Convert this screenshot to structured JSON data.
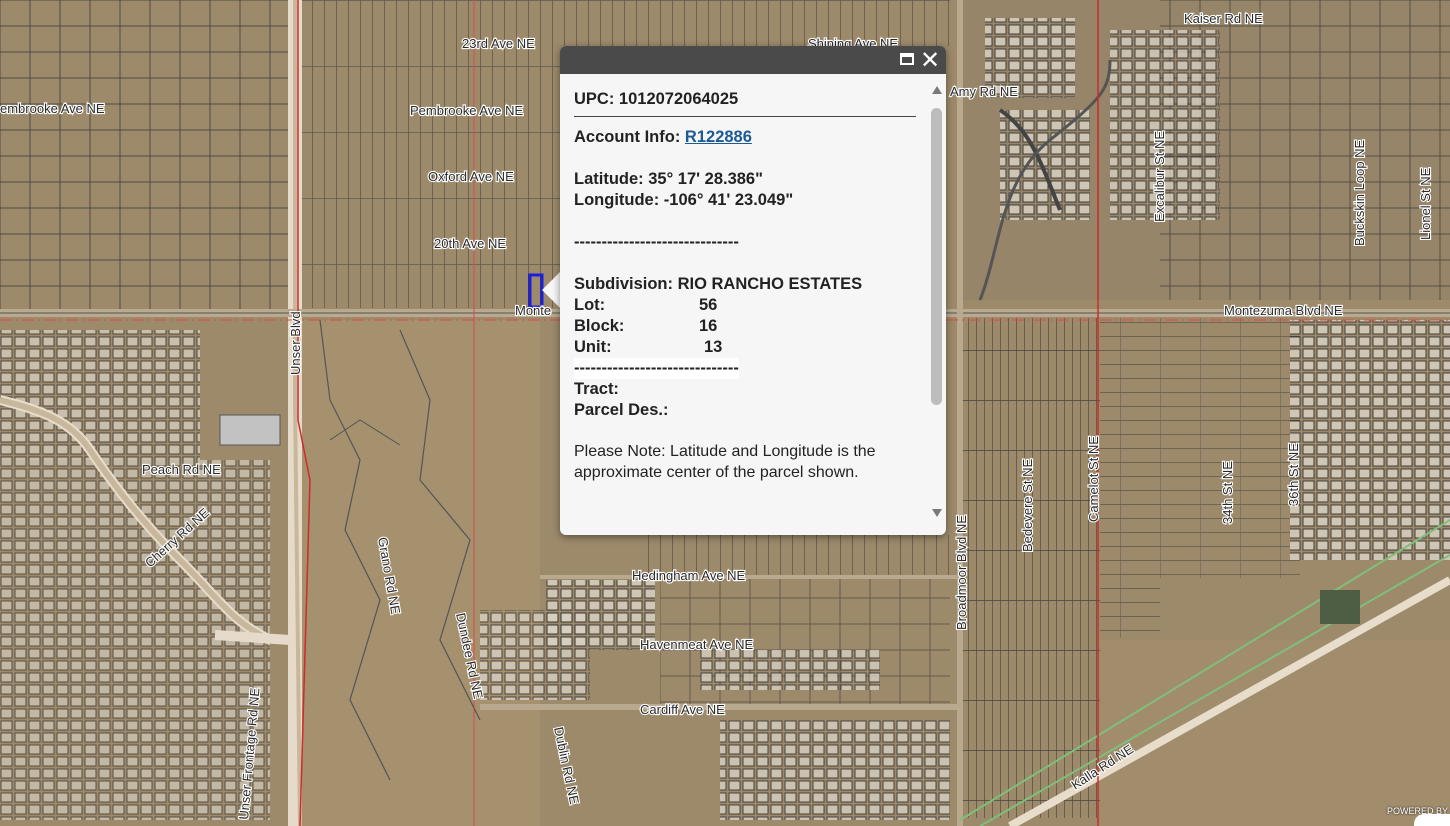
{
  "map": {
    "street_labels": [
      {
        "id": "23rd",
        "text": "23rd Ave NE"
      },
      {
        "id": "shining",
        "text": "Shining Ave NE"
      },
      {
        "id": "kaiser",
        "text": "Kaiser Rd NE"
      },
      {
        "id": "pembrooke-w",
        "text": "embrooke Ave NE"
      },
      {
        "id": "pembrooke",
        "text": "Pembrooke Ave NE"
      },
      {
        "id": "oxford",
        "text": "Oxford Ave NE"
      },
      {
        "id": "20th",
        "text": "20th Ave NE"
      },
      {
        "id": "amy",
        "text": "Amy Rd NE"
      },
      {
        "id": "montezuma-w",
        "text": "Monte"
      },
      {
        "id": "montezuma",
        "text": "Montezuma Blvd NE"
      },
      {
        "id": "hedingham",
        "text": "Hedingham Ave NE"
      },
      {
        "id": "havenmeat",
        "text": "Havenmeat Ave NE"
      },
      {
        "id": "cardiff",
        "text": "Cardiff Ave NE"
      },
      {
        "id": "peach",
        "text": "Peach Rd NE"
      },
      {
        "id": "cherry",
        "text": "Cherry Rd NE"
      },
      {
        "id": "kalia",
        "text": "Kalla Rd NE"
      },
      {
        "id": "unser",
        "text": "Unser Blvd"
      },
      {
        "id": "unser-frontage",
        "text": "Unser Frontage Rd NE"
      },
      {
        "id": "broadmoor",
        "text": "Broadmoor Blvd NE"
      },
      {
        "id": "bedevere",
        "text": "Bedevere St NE"
      },
      {
        "id": "camelot",
        "text": "Camelot St NE"
      },
      {
        "id": "excalibur",
        "text": "Excalibur St NE"
      },
      {
        "id": "34th",
        "text": "34th St NE"
      },
      {
        "id": "36th",
        "text": "36th St NE"
      },
      {
        "id": "buckskin",
        "text": "Buckskin Loop NE"
      },
      {
        "id": "lionel",
        "text": "Lionel St NE"
      },
      {
        "id": "grano",
        "text": "Grano Rd NE"
      },
      {
        "id": "dundee",
        "text": "Dundee Rd NE"
      },
      {
        "id": "dublin",
        "text": "Dublin Rd NE"
      }
    ],
    "attribution": "POWERED BY"
  },
  "popup": {
    "upc_label": "UPC: 1012072064025",
    "account_label": "Account Info:",
    "account_link": "R122886",
    "latitude": "Latitude: 35° 17' 28.386\"",
    "longitude": "Longitude: -106° 41' 23.049\"",
    "divider": "------------------------------",
    "subdivision": "Subdivision: RIO RANCHO ESTATES",
    "rows": [
      {
        "key": "Lot:",
        "value": "56"
      },
      {
        "key": "Block:",
        "value": "16"
      },
      {
        "key": "Unit:",
        "value": "13"
      }
    ],
    "tract_label": "Tract:",
    "parcel_des_label": "Parcel Des.:",
    "note": "Please Note: Latitude and Longitude is the approximate center of the parcel shown.",
    "close_glyph": "✕"
  }
}
